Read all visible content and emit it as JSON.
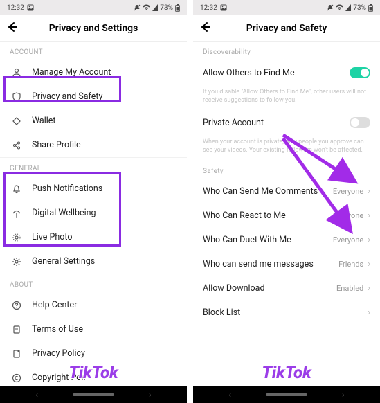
{
  "statusbar": {
    "time": "12:32",
    "battery": "73%"
  },
  "left": {
    "title": "Privacy and Settings",
    "sections": {
      "account": {
        "label": "ACCOUNT",
        "items": [
          {
            "label": "Manage My Account"
          },
          {
            "label": "Privacy and Safety"
          },
          {
            "label": "Wallet"
          },
          {
            "label": "Share Profile"
          }
        ]
      },
      "general": {
        "label": "GENERAL",
        "items": [
          {
            "label": "Push Notifications"
          },
          {
            "label": "Digital Wellbeing"
          },
          {
            "label": "Live Photo"
          },
          {
            "label": "General Settings"
          }
        ]
      },
      "about": {
        "label": "ABOUT",
        "items": [
          {
            "label": "Help Center"
          },
          {
            "label": "Terms of Use"
          },
          {
            "label": "Privacy Policy"
          },
          {
            "label": "Copyright Poli"
          }
        ]
      }
    }
  },
  "right": {
    "title": "Privacy and Safety",
    "discover": {
      "label": "Discoverability",
      "allow_find": {
        "label": "Allow Others to Find Me",
        "on": true
      },
      "allow_find_hint": "If you disable \"Allow Others to Find Me\", other users will not receive suggestions to follow you.",
      "private": {
        "label": "Private Account",
        "on": false
      },
      "private_hint": "When your account is private, only people you approve can see your videos. Your existing followers won't be affected."
    },
    "safety": {
      "label": "Safety",
      "items": [
        {
          "label": "Who Can Send Me Comments",
          "value": "Everyone"
        },
        {
          "label": "Who Can React to Me",
          "value": "Everyone"
        },
        {
          "label": "Who Can Duet With Me",
          "value": "Everyone"
        },
        {
          "label": "Who can send me messages",
          "value": "Friends"
        },
        {
          "label": "Allow Download",
          "value": "Enabled"
        },
        {
          "label": "Block List",
          "value": ""
        }
      ]
    }
  },
  "watermark": "TikTok"
}
